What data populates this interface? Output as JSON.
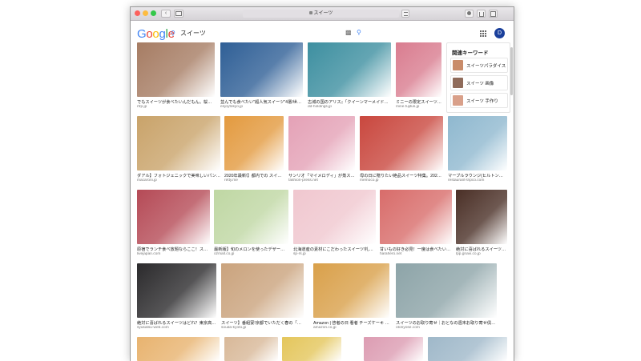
{
  "browser": {
    "url": "スイーツ",
    "back_label": "‹",
    "colors": {
      "close": "#fc615d",
      "minimize": "#fdbc40",
      "zoom": "#34c84a"
    }
  },
  "google": {
    "logo_letters": [
      {
        "ch": "G",
        "color": "#4285f4"
      },
      {
        "ch": "o",
        "color": "#ea4335"
      },
      {
        "ch": "o",
        "color": "#fbbc05"
      },
      {
        "ch": "g",
        "color": "#4285f4"
      },
      {
        "ch": "l",
        "color": "#34a853"
      },
      {
        "ch": "e",
        "color": "#ea4335"
      }
    ],
    "query": "スイーツ",
    "avatar_letter": "D"
  },
  "related": {
    "title": "関連キーワード",
    "items": [
      {
        "label": "スイーツパラダイス",
        "color": "#c98c6a"
      },
      {
        "label": "スイーツ 画像",
        "color": "#8f6b5a"
      },
      {
        "label": "スイーツ 手作り",
        "color": "#d9a08a"
      }
    ]
  },
  "results": [
    {
      "caption": "でもスイーツが食べたいんだもん。桜内の…",
      "source": "rtrp.jp",
      "color": "#a67c63"
    },
    {
      "caption": "並んでも食べたい\"超人気スイーツ\"4選/世界に…",
      "source": "enjoytokyo.jp",
      "color": "#2f5f96"
    },
    {
      "caption": "古城の国のアリス』「クイーンマーメイドから…",
      "source": "dd-holdings.jp",
      "color": "#3d8fa0"
    },
    {
      "caption": "ミニーの限定スイーツ…",
      "source": "mine.fujitus.jp",
      "color": "#d97c8f"
    },
    {
      "caption": "ダアル】フォトジェニックで美味しいパンケー…",
      "source": "macaroni.jp",
      "color": "#c9a36a"
    },
    {
      "caption": "2020年最新!】都内での スイ…",
      "source": "retty.me",
      "color": "#e39a3f"
    },
    {
      "caption": "サンリオ「マイメロディ」が蒸スイ…",
      "source": "fashion-press.net",
      "color": "#e4a1b6"
    },
    {
      "caption": "母の日に贈りたい絶品スイーツ特集。2020年…",
      "source": "memoco.jp",
      "color": "#c9473e"
    },
    {
      "caption": "マーブルラウンジ(ヒルトン東京)…",
      "source": "restaurant-tripco.com",
      "color": "#8fb8cf"
    },
    {
      "caption": "原宿でランチ食べ放題ならここ！スイ…",
      "source": "livejapan.com",
      "color": "#b54a56"
    },
    {
      "caption": "最新版】旬のメロンを使ったデザート10…",
      "source": "ozmall.co.jp",
      "color": "#bfd7a3"
    },
    {
      "caption": "北海道産の素材にこだわったスイーツ!札幌…",
      "source": "sp-rs.jp",
      "color": "#f0c7cf"
    },
    {
      "caption": "甘いもの好き必見！一度は食べたい…",
      "source": "harahero.net",
      "color": "#d86c6a"
    },
    {
      "caption": "絶対に喜ばれるスイーツ…",
      "source": "lpp.gnavi.co.jp",
      "color": "#4a2f26"
    },
    {
      "caption": "絶対に喜ばれるスイーツはどれ？東京高級…",
      "source": "syukatsu-web.com",
      "color": "#2b2a2c"
    },
    {
      "caption": "スイーツ】番組宴!京都でいただく春の「桜スイ…",
      "source": "souda-kyoto.jp",
      "color": "#caa37d"
    },
    {
      "caption": "Amazon | 啓者の日 看者 チーズケーキ スイ…",
      "source": "amazon.co.jp",
      "color": "#d9a04a"
    },
    {
      "caption": "スイーツのお取り寄せ｜おとなの週末お取り寄せ倶楽部 本店",
      "source": "otoriyose.com",
      "color": "#8da4a8"
    },
    {
      "caption": "",
      "source": "",
      "color": "#e8b36f"
    },
    {
      "caption": "",
      "source": "",
      "color": "#d8b898"
    },
    {
      "caption": "",
      "source": "",
      "color": "#e4c65b"
    },
    {
      "caption": "",
      "source": "",
      "color": "#dc9cb2"
    },
    {
      "caption": "",
      "source": "",
      "color": "#9fb8c9"
    }
  ]
}
